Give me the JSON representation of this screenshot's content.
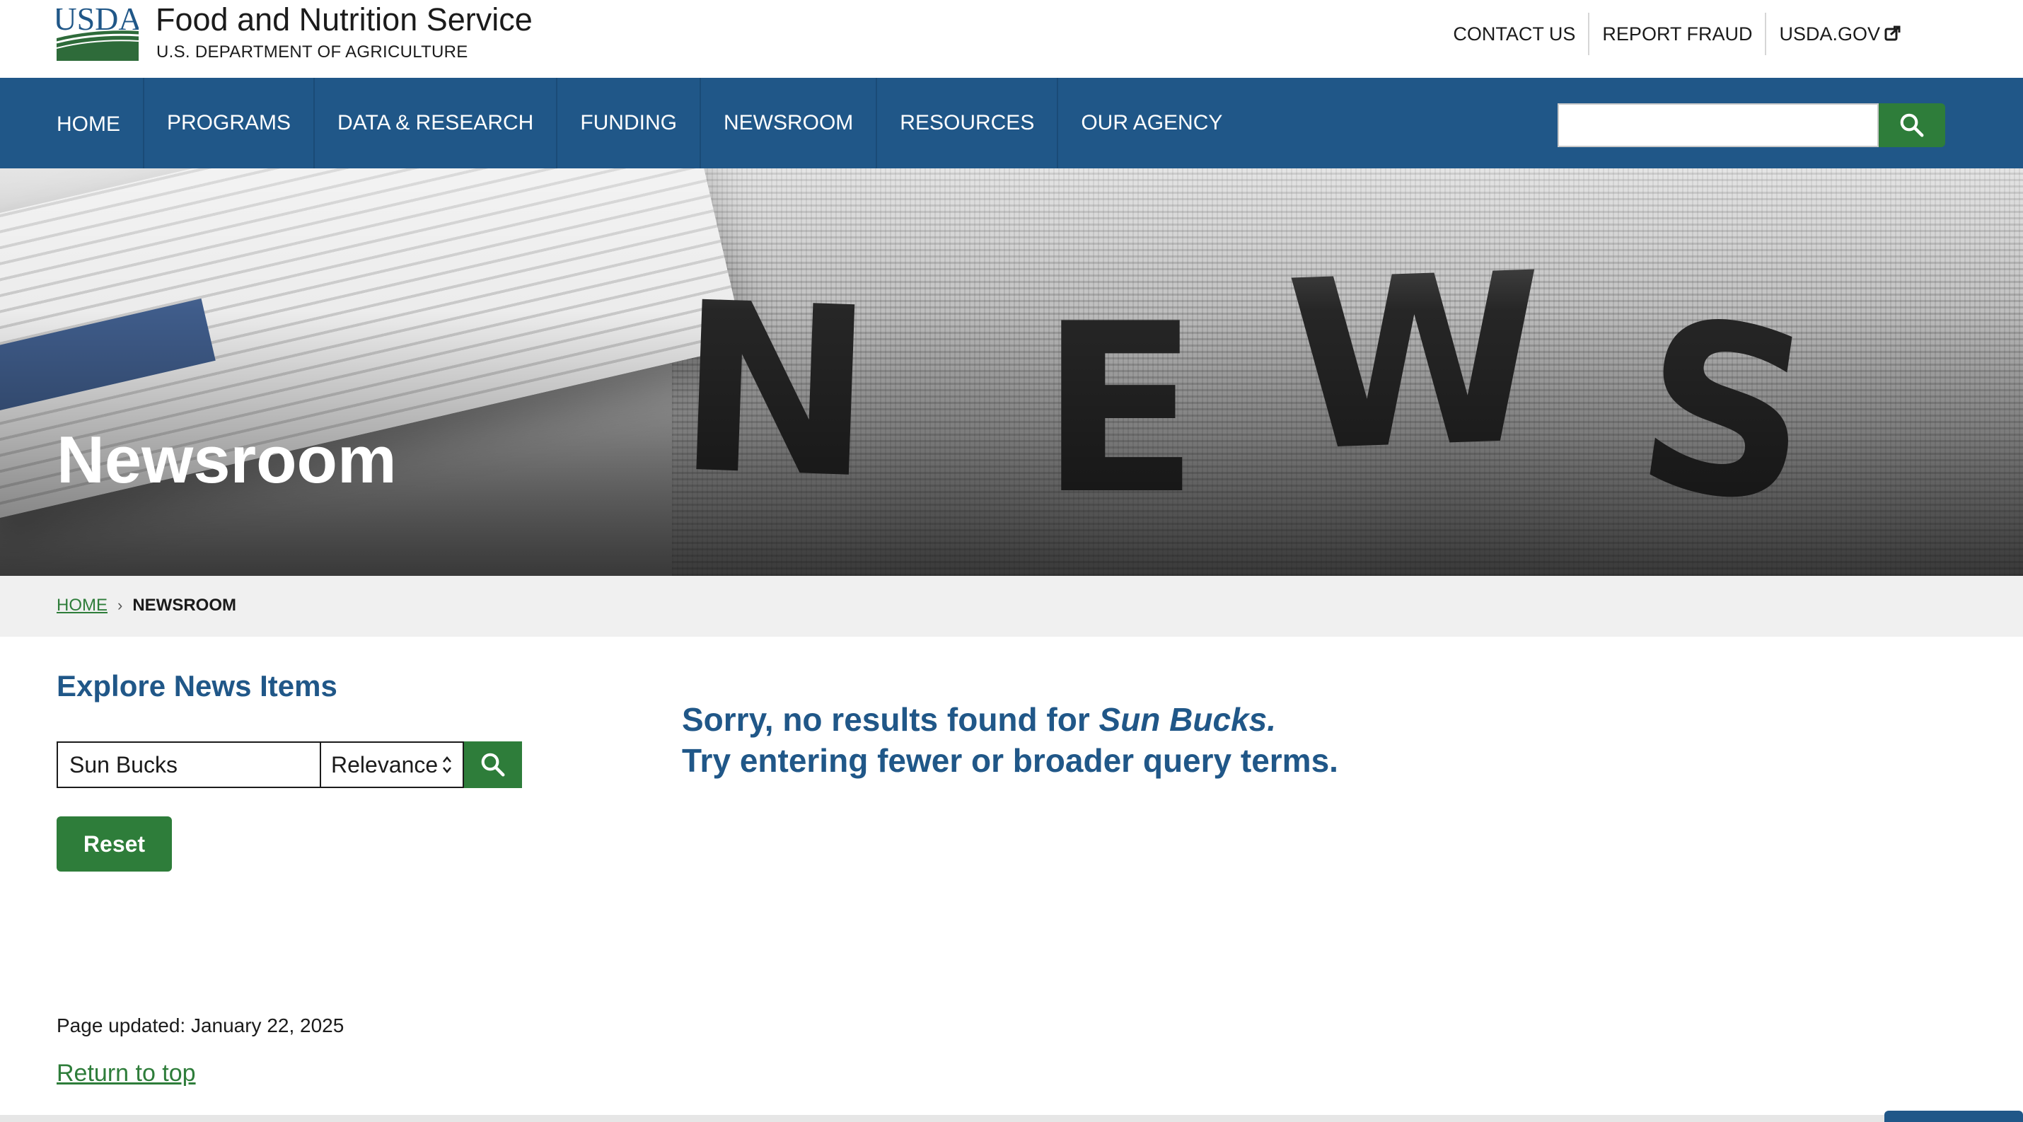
{
  "header": {
    "logo_text": "USDA",
    "site_title": "Food and Nutrition Service",
    "site_subtitle": "U.S. DEPARTMENT OF AGRICULTURE",
    "utility_links": [
      {
        "label": "CONTACT US"
      },
      {
        "label": "REPORT FRAUD"
      },
      {
        "label": "USDA.GOV",
        "icon": "external-link-icon"
      }
    ]
  },
  "nav": {
    "items": [
      {
        "label": "HOME"
      },
      {
        "label": "PROGRAMS"
      },
      {
        "label": "DATA & RESEARCH"
      },
      {
        "label": "FUNDING"
      },
      {
        "label": "NEWSROOM"
      },
      {
        "label": "RESOURCES"
      },
      {
        "label": "OUR AGENCY"
      }
    ],
    "search": {
      "value": "",
      "button_icon": "search-icon"
    }
  },
  "hero": {
    "image_letters": [
      "N",
      "E",
      "W",
      "S"
    ],
    "title": "Newsroom"
  },
  "breadcrumb": {
    "home": "HOME",
    "separator": "›",
    "current": "NEWSROOM"
  },
  "explore": {
    "title": "Explore News Items",
    "query_value": "Sun Bucks",
    "sort_value": "Relevance",
    "search_button_icon": "search-icon",
    "reset_label": "Reset"
  },
  "results": {
    "message_prefix": "Sorry, no results found for ",
    "query": "Sun Bucks.",
    "message_line2": "Try entering fewer or broader query terms."
  },
  "footer": {
    "updated": "Page updated: January 22, 2025",
    "return_to_top": "Return to top"
  },
  "colors": {
    "nav_blue": "#205788",
    "usda_green": "#2e7d3a",
    "breadcrumb_bg": "#f0f0f0"
  }
}
